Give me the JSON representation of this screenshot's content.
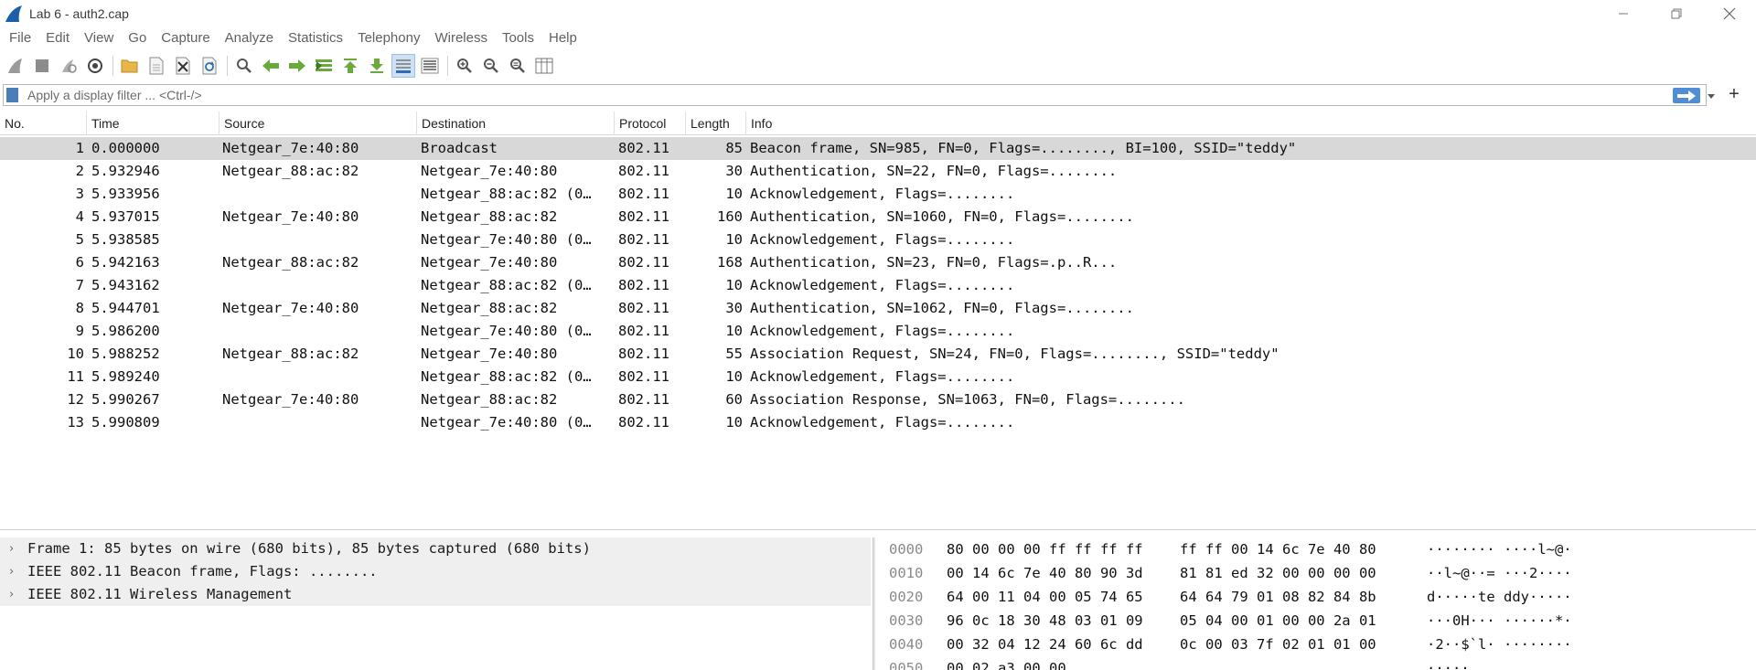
{
  "window": {
    "title": "Lab 6 - auth2.cap"
  },
  "menu": [
    "File",
    "Edit",
    "View",
    "Go",
    "Capture",
    "Analyze",
    "Statistics",
    "Telephony",
    "Wireless",
    "Tools",
    "Help"
  ],
  "filter": {
    "placeholder": "Apply a display filter ... <Ctrl-/>",
    "value": ""
  },
  "packet_list": {
    "columns": [
      "No.",
      "Time",
      "Source",
      "Destination",
      "Protocol",
      "Length",
      "Info"
    ],
    "rows": [
      {
        "no": "1",
        "time": "0.000000",
        "src": "Netgear_7e:40:80",
        "dst": "Broadcast",
        "proto": "802.11",
        "len": "85",
        "info": "Beacon frame, SN=985, FN=0, Flags=........, BI=100, SSID=\"teddy\""
      },
      {
        "no": "2",
        "time": "5.932946",
        "src": "Netgear_88:ac:82",
        "dst": "Netgear_7e:40:80",
        "proto": "802.11",
        "len": "30",
        "info": "Authentication, SN=22, FN=0, Flags=........"
      },
      {
        "no": "3",
        "time": "5.933956",
        "src": "",
        "dst": "Netgear_88:ac:82 (0…",
        "proto": "802.11",
        "len": "10",
        "info": "Acknowledgement, Flags=........"
      },
      {
        "no": "4",
        "time": "5.937015",
        "src": "Netgear_7e:40:80",
        "dst": "Netgear_88:ac:82",
        "proto": "802.11",
        "len": "160",
        "info": "Authentication, SN=1060, FN=0, Flags=........"
      },
      {
        "no": "5",
        "time": "5.938585",
        "src": "",
        "dst": "Netgear_7e:40:80 (0…",
        "proto": "802.11",
        "len": "10",
        "info": "Acknowledgement, Flags=........"
      },
      {
        "no": "6",
        "time": "5.942163",
        "src": "Netgear_88:ac:82",
        "dst": "Netgear_7e:40:80",
        "proto": "802.11",
        "len": "168",
        "info": "Authentication, SN=23, FN=0, Flags=.p..R..."
      },
      {
        "no": "7",
        "time": "5.943162",
        "src": "",
        "dst": "Netgear_88:ac:82 (0…",
        "proto": "802.11",
        "len": "10",
        "info": "Acknowledgement, Flags=........"
      },
      {
        "no": "8",
        "time": "5.944701",
        "src": "Netgear_7e:40:80",
        "dst": "Netgear_88:ac:82",
        "proto": "802.11",
        "len": "30",
        "info": "Authentication, SN=1062, FN=0, Flags=........"
      },
      {
        "no": "9",
        "time": "5.986200",
        "src": "",
        "dst": "Netgear_7e:40:80 (0…",
        "proto": "802.11",
        "len": "10",
        "info": "Acknowledgement, Flags=........"
      },
      {
        "no": "10",
        "time": "5.988252",
        "src": "Netgear_88:ac:82",
        "dst": "Netgear_7e:40:80",
        "proto": "802.11",
        "len": "55",
        "info": "Association Request, SN=24, FN=0, Flags=........, SSID=\"teddy\""
      },
      {
        "no": "11",
        "time": "5.989240",
        "src": "",
        "dst": "Netgear_88:ac:82 (0…",
        "proto": "802.11",
        "len": "10",
        "info": "Acknowledgement, Flags=........"
      },
      {
        "no": "12",
        "time": "5.990267",
        "src": "Netgear_7e:40:80",
        "dst": "Netgear_88:ac:82",
        "proto": "802.11",
        "len": "60",
        "info": "Association Response, SN=1063, FN=0, Flags=........"
      },
      {
        "no": "13",
        "time": "5.990809",
        "src": "",
        "dst": "Netgear_7e:40:80 (0…",
        "proto": "802.11",
        "len": "10",
        "info": "Acknowledgement, Flags=........"
      }
    ]
  },
  "details": [
    "Frame 1: 85 bytes on wire (680 bits), 85 bytes captured (680 bits)",
    "IEEE 802.11 Beacon frame, Flags: ........",
    "IEEE 802.11 Wireless Management"
  ],
  "bytes": [
    {
      "offset": "0000",
      "hex1": "80 00 00 00 ff ff ff ff",
      "hex2": "ff ff 00 14 6c 7e 40 80",
      "ascii": "········ ····l~@·"
    },
    {
      "offset": "0010",
      "hex1": "00 14 6c 7e 40 80 90 3d",
      "hex2": "81 81 ed 32 00 00 00 00",
      "ascii": "··l~@··= ···2····"
    },
    {
      "offset": "0020",
      "hex1": "64 00 11 04 00 05 74 65",
      "hex2": "64 64 79 01 08 82 84 8b",
      "ascii": "d·····te ddy·····"
    },
    {
      "offset": "0030",
      "hex1": "96 0c 18 30 48 03 01 09",
      "hex2": "05 04 00 01 00 00 2a 01",
      "ascii": "···0H··· ······*·"
    },
    {
      "offset": "0040",
      "hex1": "00 32 04 12 24 60 6c dd",
      "hex2": "0c 00 03 7f 02 01 01 00",
      "ascii": "·2··$`l· ········"
    },
    {
      "offset": "0050",
      "hex1": "00 02 a3 00 00",
      "hex2": "",
      "ascii": "·····"
    }
  ],
  "colors": {
    "selected_row": "#d8d8d8",
    "accent": "#4f8ed6",
    "detail_bg": "#efefef"
  },
  "icons": [
    "shark-fin-icon",
    "stop-capture-icon",
    "restart-capture-icon",
    "capture-options-icon",
    "open-file-icon",
    "save-file-icon",
    "close-file-icon",
    "reload-file-icon",
    "find-packet-icon",
    "go-back-icon",
    "go-forward-icon",
    "go-to-packet-icon",
    "go-first-icon",
    "go-last-icon",
    "autoscroll-icon",
    "colorize-icon",
    "zoom-in-icon",
    "zoom-out-icon",
    "zoom-normal-icon",
    "resize-columns-icon"
  ]
}
